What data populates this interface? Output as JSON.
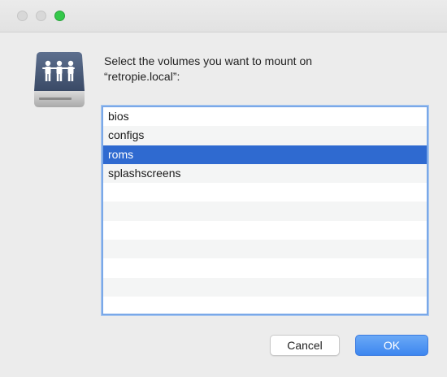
{
  "window": {
    "traffic_lights": [
      "close",
      "minimize",
      "zoom"
    ]
  },
  "icon": "network-server-icon",
  "message": {
    "line1": "Select the volumes you want to mount on",
    "line2": "“retropie.local”:"
  },
  "volumes": {
    "items": [
      "bios",
      "configs",
      "roms",
      "splashscreens",
      "",
      "",
      "",
      "",
      "",
      "",
      ""
    ],
    "selected_index": 2
  },
  "buttons": {
    "cancel": "Cancel",
    "ok": "OK"
  },
  "colors": {
    "selection": "#2f6ad0",
    "accent": "#3d86ef",
    "zoom_light": "#34c84a"
  }
}
